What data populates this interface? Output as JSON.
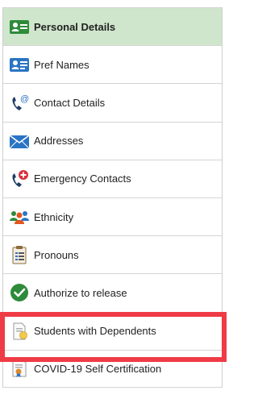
{
  "nav": {
    "items": [
      {
        "label": "Personal Details",
        "icon": "id-card-icon",
        "active": true
      },
      {
        "label": "Pref Names",
        "icon": "name-card-icon"
      },
      {
        "label": "Contact Details",
        "icon": "phone-at-icon"
      },
      {
        "label": "Addresses",
        "icon": "envelope-icon"
      },
      {
        "label": "Emergency Contacts",
        "icon": "phone-cross-icon"
      },
      {
        "label": "Ethnicity",
        "icon": "people-group-icon"
      },
      {
        "label": "Pronouns",
        "icon": "clipboard-list-icon"
      },
      {
        "label": "Authorize to release",
        "icon": "checkmark-circle-icon"
      },
      {
        "label": "Students with Dependents",
        "icon": "document-badge-icon"
      },
      {
        "label": "COVID-19 Self Certification",
        "icon": "certificate-icon"
      }
    ]
  },
  "colors": {
    "active_background": "#cfe6cc",
    "highlight_border": "#ef3b45",
    "icon_blue": "#2a74c4",
    "icon_green": "#2e8b3a"
  }
}
